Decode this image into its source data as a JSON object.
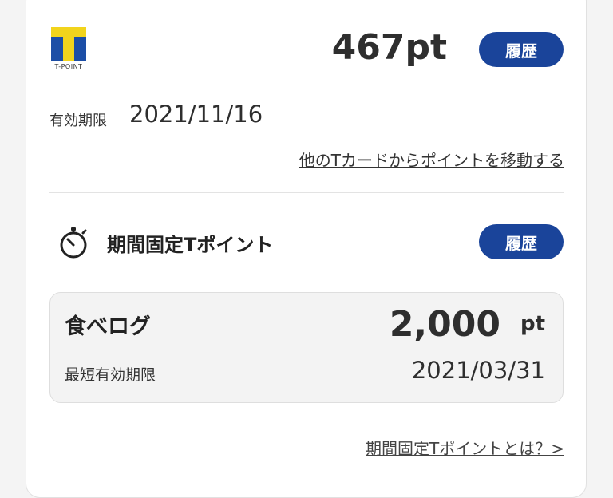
{
  "header": {
    "logo_caption": "T-POINT",
    "points": "467pt",
    "history_label": "履歴"
  },
  "expiry": {
    "label": "有効期限",
    "date": "2021/11/16"
  },
  "transfer_link": "他のTカードからポイントを移動する",
  "fixed_points": {
    "title": "期間固定Tポイント",
    "history_label": "履歴",
    "items": [
      {
        "store": "食べログ",
        "points": "2,000",
        "unit": "pt",
        "earliest_label": "最短有効期限",
        "earliest_date": "2021/03/31"
      }
    ],
    "about_link": "期間固定Tポイントとは？>"
  },
  "colors": {
    "button_bg": "#1a449a",
    "logo_blue": "#1c4ea6",
    "logo_yellow": "#f2d41c"
  },
  "icons": [
    "tpoint-logo-icon",
    "stopwatch-icon"
  ]
}
